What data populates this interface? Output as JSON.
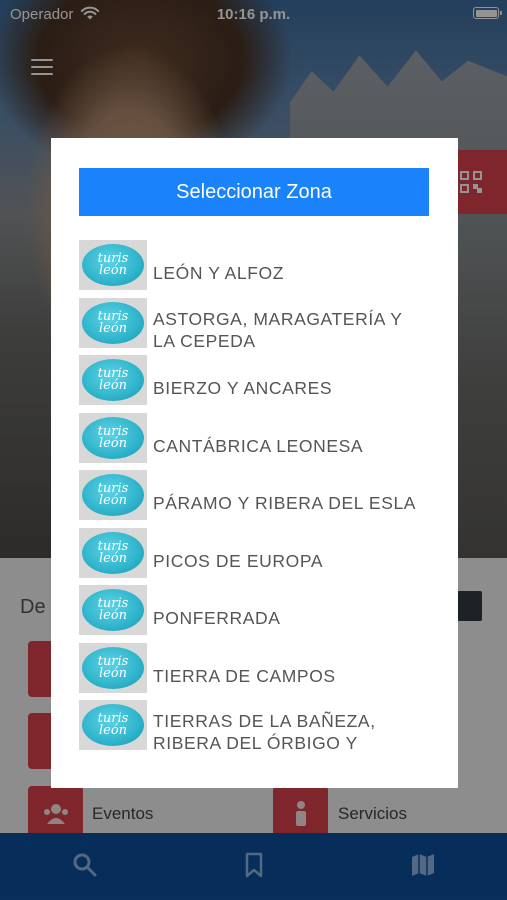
{
  "status_bar": {
    "carrier": "Operador",
    "time": "10:16 p.m."
  },
  "background": {
    "section_title": "De",
    "tiles": [
      {
        "label": "Eventos",
        "icon": "group-icon"
      },
      {
        "label": "Servicios",
        "icon": "person-icon"
      }
    ]
  },
  "dialog": {
    "title": "Seleccionar Zona",
    "logo_text": [
      "turis",
      "león"
    ],
    "zones": [
      {
        "label": "LEÓN Y ALFOZ"
      },
      {
        "label": "ASTORGA, MARAGATERÍA Y LA CEPEDA"
      },
      {
        "label": "BIERZO Y ANCARES"
      },
      {
        "label": "CANTÁBRICA LEONESA"
      },
      {
        "label": "PÁRAMO Y RIBERA DEL ESLA"
      },
      {
        "label": "PICOS DE EUROPA"
      },
      {
        "label": "PONFERRADA"
      },
      {
        "label": "TIERRA DE CAMPOS"
      },
      {
        "label": "TIERRAS DE LA BAÑEZA, RIBERA DEL ÓRBIGO Y"
      }
    ]
  },
  "tabbar": {
    "tabs": [
      {
        "icon": "search-icon"
      },
      {
        "icon": "bookmark-icon"
      },
      {
        "icon": "map-icon"
      }
    ]
  },
  "colors": {
    "accent_blue": "#1a82fb",
    "tabbar_blue": "#0d4f9e",
    "tile_red": "#d9434a",
    "logo_teal": "#2fb4cc"
  }
}
